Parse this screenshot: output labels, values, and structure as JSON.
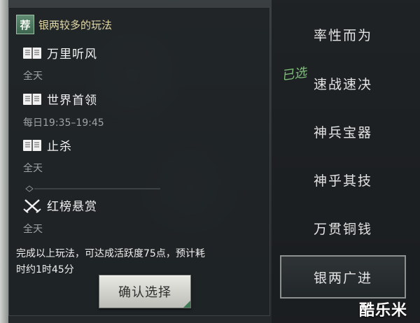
{
  "panel": {
    "badge": "荐",
    "title": "银两较多的玩法"
  },
  "activities": [
    {
      "name": "万里听风",
      "time": "全天",
      "icon": "scroll-book-icon"
    },
    {
      "name": "世界首领",
      "time": "每日19:35–19:45",
      "icon": "scroll-book-icon"
    },
    {
      "name": "止杀",
      "time": "全天",
      "icon": "scroll-book-icon"
    },
    {
      "name": "红榜悬赏",
      "time": "全天",
      "icon": "crossed-swords-icon"
    }
  ],
  "footer": {
    "line1": "完成以上玩法，可达成活跃度75点，预计耗",
    "line2": "时约1时45分"
  },
  "confirm_button": "确认选择",
  "chosen_mark": "已选",
  "options": [
    {
      "label": "率性而为",
      "selected": false
    },
    {
      "label": "速战速决",
      "selected": false
    },
    {
      "label": "神兵宝器",
      "selected": false
    },
    {
      "label": "神乎其技",
      "selected": false
    },
    {
      "label": "万贯铜钱",
      "selected": false
    },
    {
      "label": "银两广进",
      "selected": true
    }
  ],
  "watermark": "酷乐米",
  "colors": {
    "accent_green": "#3f7a57",
    "title_gold": "#e4d9a8",
    "chosen_green": "#7fbf7a"
  }
}
